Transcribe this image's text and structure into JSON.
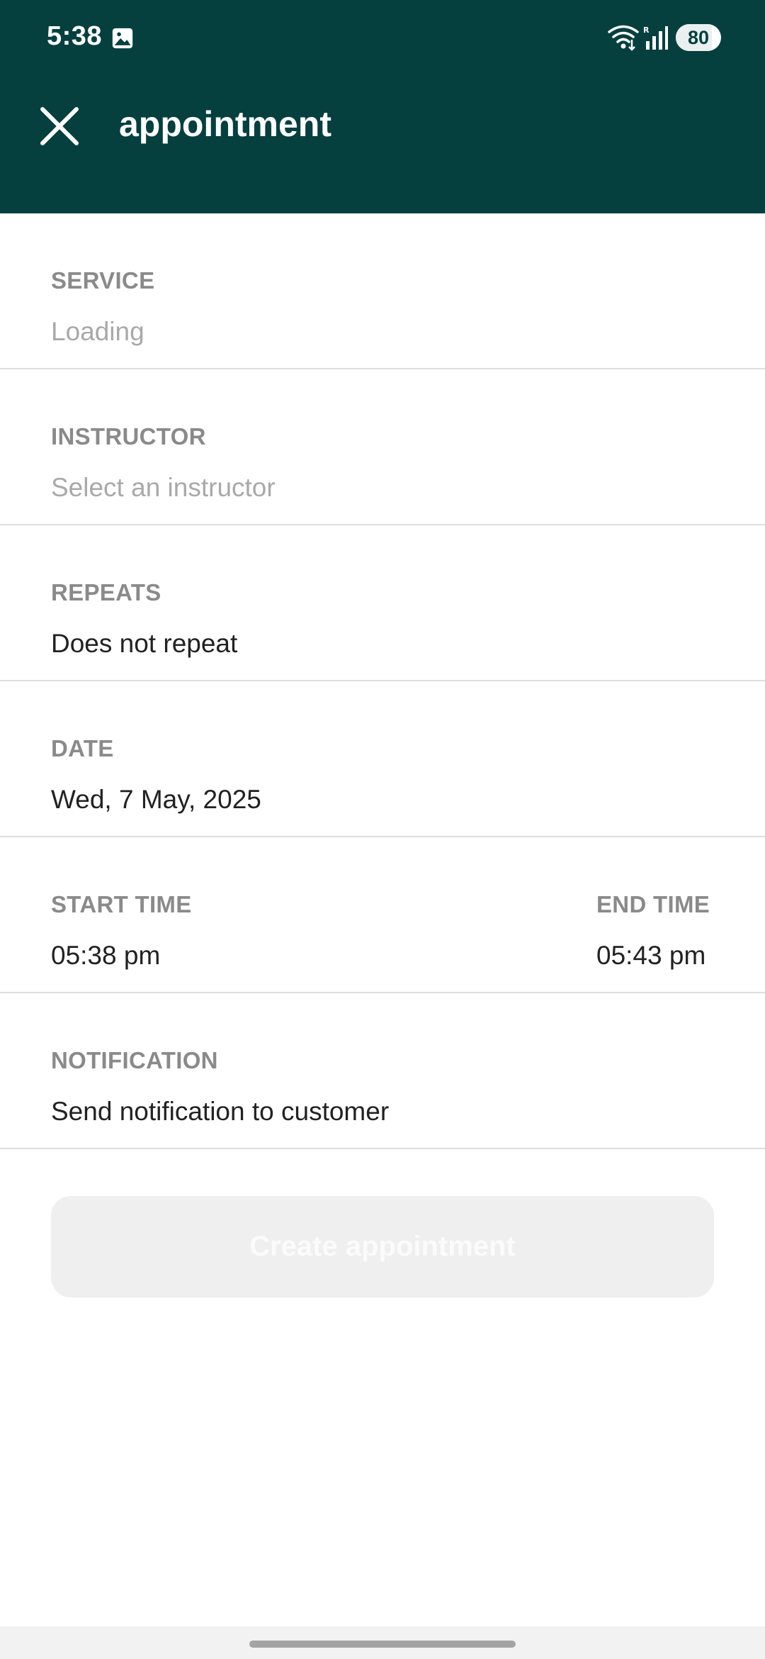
{
  "colors": {
    "header_bg": "#05403f",
    "label": "#8a8a8a",
    "value": "#222222",
    "placeholder": "#a9a9a9",
    "divider": "#dedede",
    "button_disabled_bg": "#efefef"
  },
  "status_bar": {
    "time": "5:38",
    "battery_level": "80",
    "battery_fraction": 0.8,
    "icons": [
      "gallery-icon",
      "wifi-icon",
      "signal-icon",
      "battery-icon"
    ]
  },
  "app_bar": {
    "title": "appointment",
    "close_icon": "close-icon"
  },
  "fields": {
    "service": {
      "label": "SERVICE",
      "value": "Loading"
    },
    "instructor": {
      "label": "INSTRUCTOR",
      "value": "Select an instructor"
    },
    "repeats": {
      "label": "REPEATS",
      "value": "Does not repeat"
    },
    "date": {
      "label": "DATE",
      "value": "Wed, 7 May, 2025"
    },
    "start_time": {
      "label": "START TIME",
      "value": "05:38 pm"
    },
    "end_time": {
      "label": "END TIME",
      "value": "05:43 pm"
    },
    "notification": {
      "label": "NOTIFICATION",
      "value": "Send notification to customer"
    }
  },
  "actions": {
    "create_label": "Create appointment",
    "create_enabled": false
  }
}
